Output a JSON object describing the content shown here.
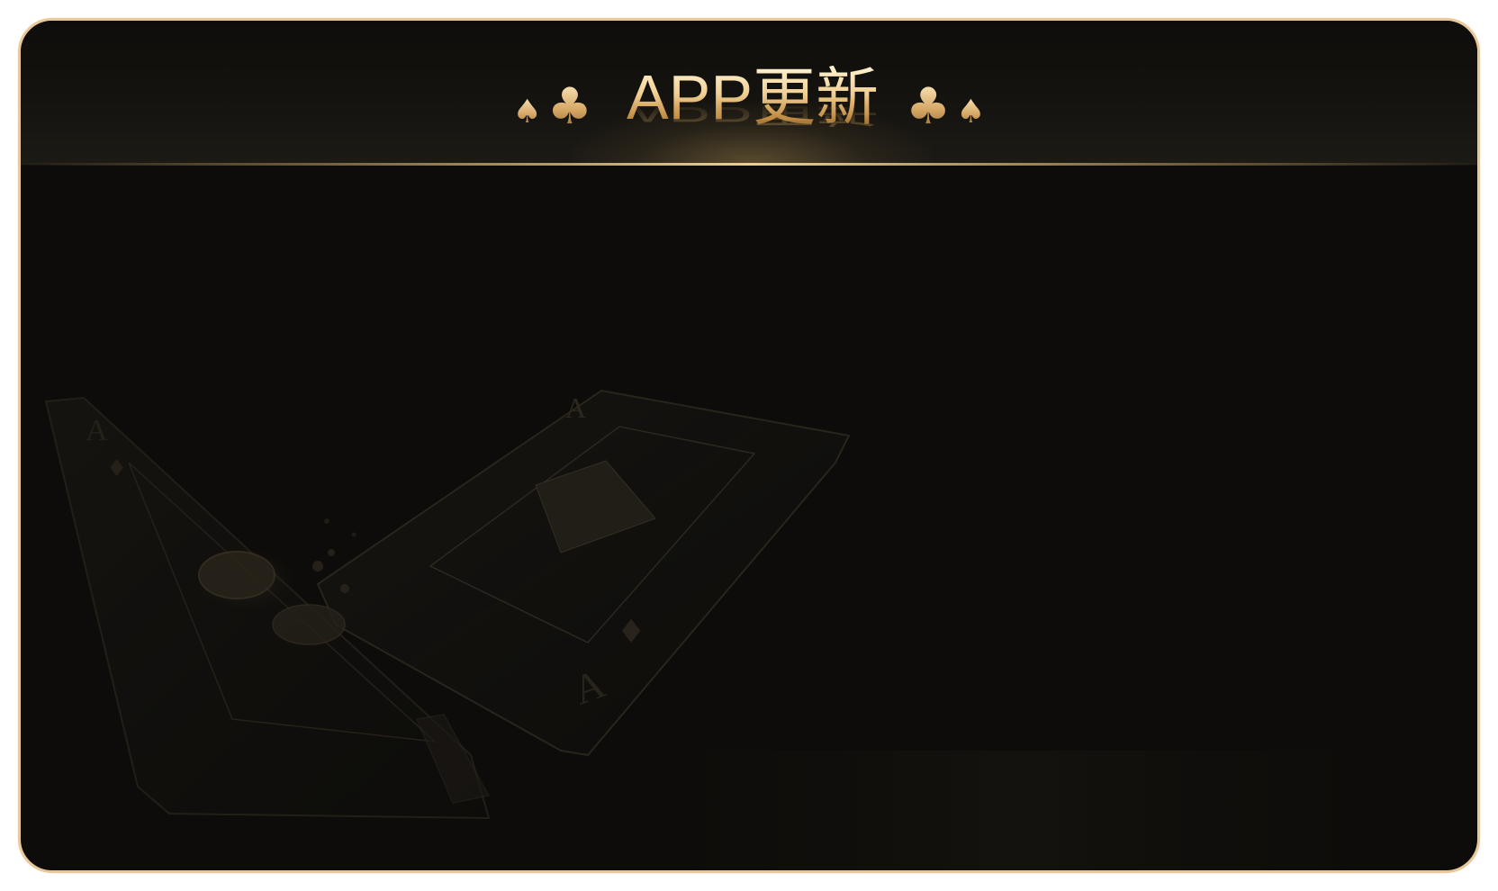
{
  "dialog": {
    "title": "APP更新",
    "decorations": {
      "left": [
        "spade-icon",
        "club-icon"
      ],
      "right": [
        "club-icon",
        "spade-icon"
      ],
      "spade_glyph": "♠",
      "club_glyph": "♣"
    }
  },
  "colors": {
    "border": "#e8c79b",
    "background": "#0d0c0a",
    "gold_light": "#fff3d4",
    "gold": "#d6a866",
    "gold_dark": "#8f6228"
  }
}
